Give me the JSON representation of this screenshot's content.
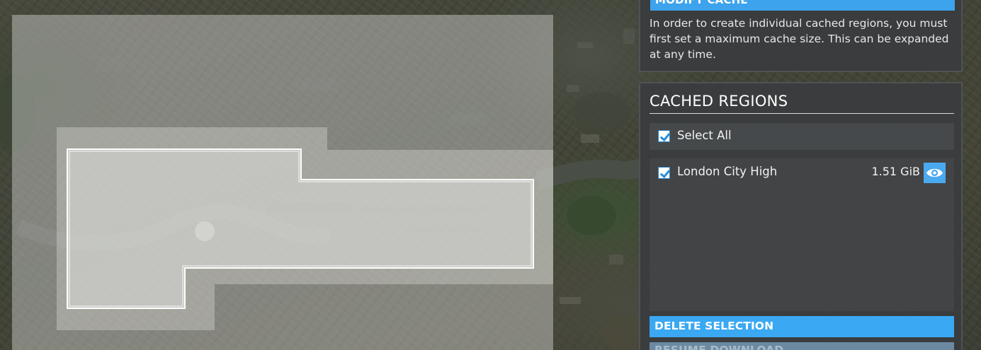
{
  "modify_cache": {
    "header": "MODIFY CACHE",
    "description": "In order to create individual cached regions, you must first set a maximum cache size. This can be expanded at any time."
  },
  "cached_regions": {
    "title": "CACHED REGIONS",
    "select_all_label": "Select All",
    "select_all_checked": true,
    "items": [
      {
        "name": "London City High",
        "size": "1.51 GiB",
        "checked": true,
        "visible": true
      }
    ],
    "delete_label": "DELETE SELECTION",
    "resume_label": "RESUME DOWNLOAD"
  },
  "icons": {
    "checkbox": "checkbox-checked-icon",
    "visibility": "eye-icon"
  },
  "colors": {
    "accent": "#3aa8f2",
    "panel_bg": "#3a3c3e",
    "text": "#ffffff"
  }
}
